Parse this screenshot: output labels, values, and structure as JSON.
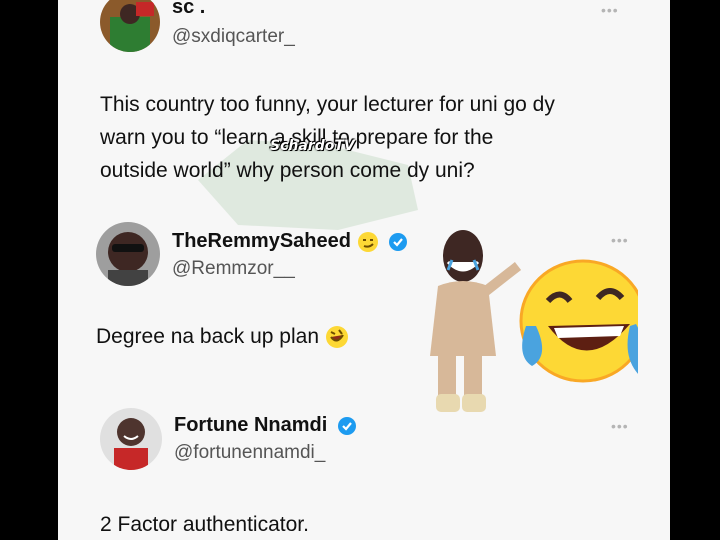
{
  "tweets": [
    {
      "name": "sc .",
      "handle": "@sxdiqcarter_",
      "text_lines": [
        "This country too funny, your lecturer for uni go dy",
        "warn you to “learn a skill to prepare for the",
        "outside world” why person come dy uni?"
      ],
      "verified": false
    },
    {
      "name": "TheRemmySaheed",
      "handle": "@Remmzor__",
      "text": "Degree na back up plan",
      "verified": true,
      "name_emoji": "smirk-face-emoji",
      "text_emoji": "rofl-emoji"
    },
    {
      "name": "Fortune Nnamdi",
      "handle": "@fortunennamdi_",
      "text": "2 Factor authenticator.",
      "verified": true
    }
  ],
  "more_label": "•••",
  "watermark": "SchardoTV",
  "colors": {
    "verified": "#1d9bf0",
    "background": "#f7f7f7",
    "emoji_yellow": "#fdd835",
    "tear_blue": "#4aa3df"
  },
  "sticker": {
    "description_icons": [
      "laughing-emoji-sticker",
      "dancing-boy-sticker"
    ]
  }
}
